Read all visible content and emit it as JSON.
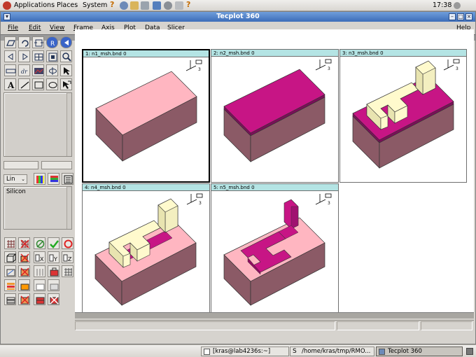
{
  "top_panel": {
    "menus": [
      "Applications",
      "Places",
      "System"
    ],
    "clock": "17:38"
  },
  "window": {
    "title": "Tecplot 360",
    "menu": [
      "File",
      "Edit",
      "View",
      "Frame",
      "Axis",
      "Plot",
      "Data",
      "Slicer"
    ],
    "help": "Help"
  },
  "palette": {
    "contour_select": "Lin",
    "zone_list_item": "Silicon"
  },
  "frames": [
    {
      "label": "1: n1_msh.bnd 0",
      "active": true
    },
    {
      "label": "2: n2_msh.bnd 0",
      "active": false
    },
    {
      "label": "3: n3_msh.bnd 0",
      "active": false
    },
    {
      "label": "4: n4_msh.bnd 0",
      "active": false
    },
    {
      "label": "5: n5_msh.bnd 0",
      "active": false
    }
  ],
  "axis_triad": {
    "y": "Y",
    "z": "Z",
    "x": "X",
    "count": "3"
  },
  "colors": {
    "silicon_top": "#ffb6c1",
    "silicon_side": "#8b5a66",
    "layer_magenta": "#c71585",
    "poly_cream": "#fffacd",
    "frame_header": "#b4e4e4",
    "titlebar": "#3c6cb8"
  },
  "taskbar": {
    "tasks": [
      "[kras@lab4236s:~]",
      "/home/kras/tmp/RMO...",
      "Tecplot 360"
    ]
  }
}
